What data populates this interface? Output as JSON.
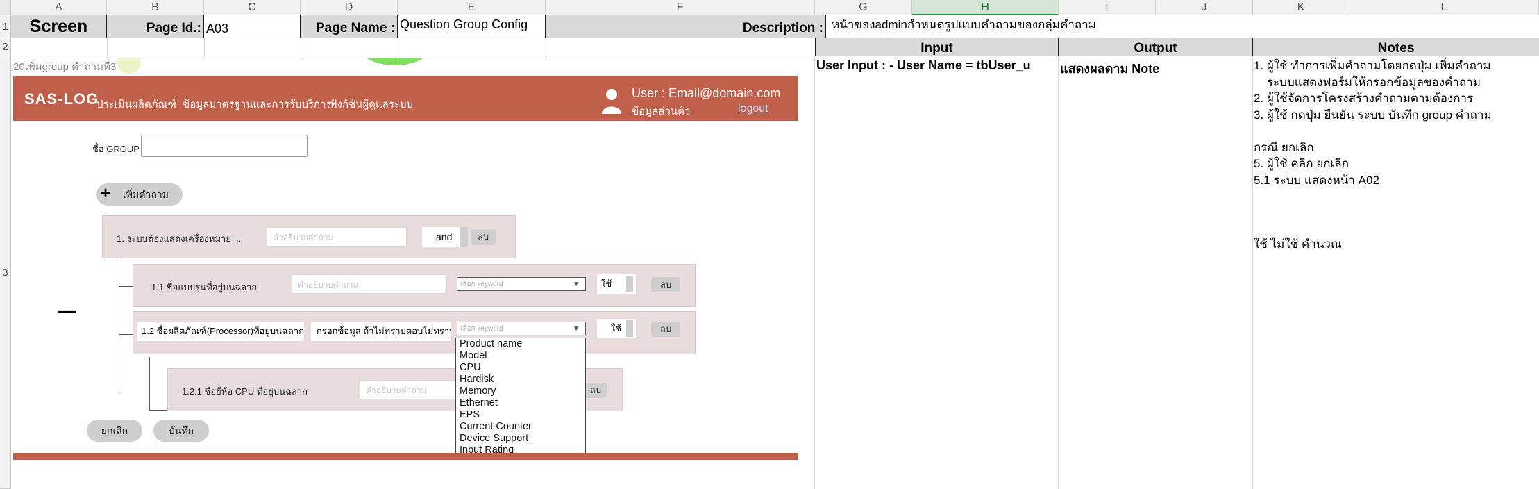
{
  "sheet": {
    "columns": [
      "A",
      "B",
      "C",
      "D",
      "E",
      "F",
      "G",
      "H",
      "I",
      "J",
      "K",
      "L"
    ],
    "rows": [
      "1",
      "2",
      "3"
    ],
    "row1": {
      "screen_label": "Screen",
      "page_id_label": "Page Id.:",
      "page_id_value": "A03",
      "page_name_label": "Page Name :",
      "page_name_value": "Question Group Config",
      "description_label": "Description :",
      "description_value": "หน้าของadminกำหนดรูปแบบคำถามของกลุ่มคำถาม"
    },
    "row2": {
      "input": "Input",
      "output": "Output",
      "notes": "Notes"
    },
    "row3": {
      "input_text": "User Input :  - User Name = tbUser_u",
      "output_text": "แสดงผลตาม Note",
      "notes": [
        "1. ผู้ใช้ ทำการเพิ่มคำถามโดยกดปุ่ม เพิ่มคำถาม",
        "    ระบบแสดงฟอร์มให้กรอกข้อมูลของคำถาม",
        "2. ผู้ใช้จัดการโครงสร้างคำถามตามต้องการ",
        "3. ผู้ใช้ กดปุ่ม ยืนยัน ระบบ บันทึก group คำถาม",
        "",
        "กรณี ยกเลิก",
        "5. ผู้ใช้ คลิก ยกเลิก",
        "5.1 ระบบ แสดงหน้า A02"
      ],
      "notes_extra": "ใช้ ไม่ใช้  คำนวณ"
    }
  },
  "mockup": {
    "breadcrumb": "20เพิ่มgroup คำถามที่3",
    "logo": "SAS-LOG",
    "menu": [
      "ประเมินผลิตภัณฑ์",
      "ข้อมูลมาตรฐานและการรับบริการ",
      "ฟังก์ชันผู้ดูแลระบบ"
    ],
    "user_label": "User : Email@domain.com",
    "profile_label": "ข้อมูลส่วนตัว",
    "logout_label": "logout",
    "group_name_label": "ชื่อ GROUP",
    "group_name_value": "",
    "add_question_label": "เพิ่มคำถาม",
    "q1": {
      "label": "1. ระบบต้องแสดงเครื่องหมาย ...",
      "placeholder": "คำอธิบายคำถาม",
      "logic": "and",
      "delete": "ลบ"
    },
    "q1_1": {
      "label": "1.1 ชื่อแบบรุ่นที่อยู่บนฉลาก",
      "placeholder": "คำอธิบายคำถาม",
      "keyword_placeholder": "เลือก keyword",
      "use": "ใช้",
      "delete": "ลบ"
    },
    "q1_2": {
      "label": "1.2 ชื่อผลิตภัณฑ์(Processor)ที่อยู่บนฉลาก",
      "description": "กรอกข้อมูล ถ้าไม่ทราบตอบไม่ทราบ",
      "keyword_placeholder": "เลือก keyword",
      "use": "ใช้",
      "delete": "ลบ"
    },
    "q1_2_1": {
      "label": "1.2.1 ชื่อยี่ห้อ CPU ที่อยู่บนฉลาก",
      "placeholder": "คำอธิบายคำถาม",
      "delete": "ลบ"
    },
    "keyword_options": [
      "Product name",
      "Model",
      "CPU",
      "Hardisk",
      "Memory",
      "Ethernet",
      "EPS",
      "Current Counter",
      "Device Support",
      "Input Rating"
    ],
    "cancel_label": "ยกเลิก",
    "save_label": "บันทึก",
    "collapse_icon_label": "—"
  },
  "colors": {
    "navbar": "#c0604a",
    "selected_column": "#d2e5d6",
    "panel": "#e9dcdc"
  }
}
